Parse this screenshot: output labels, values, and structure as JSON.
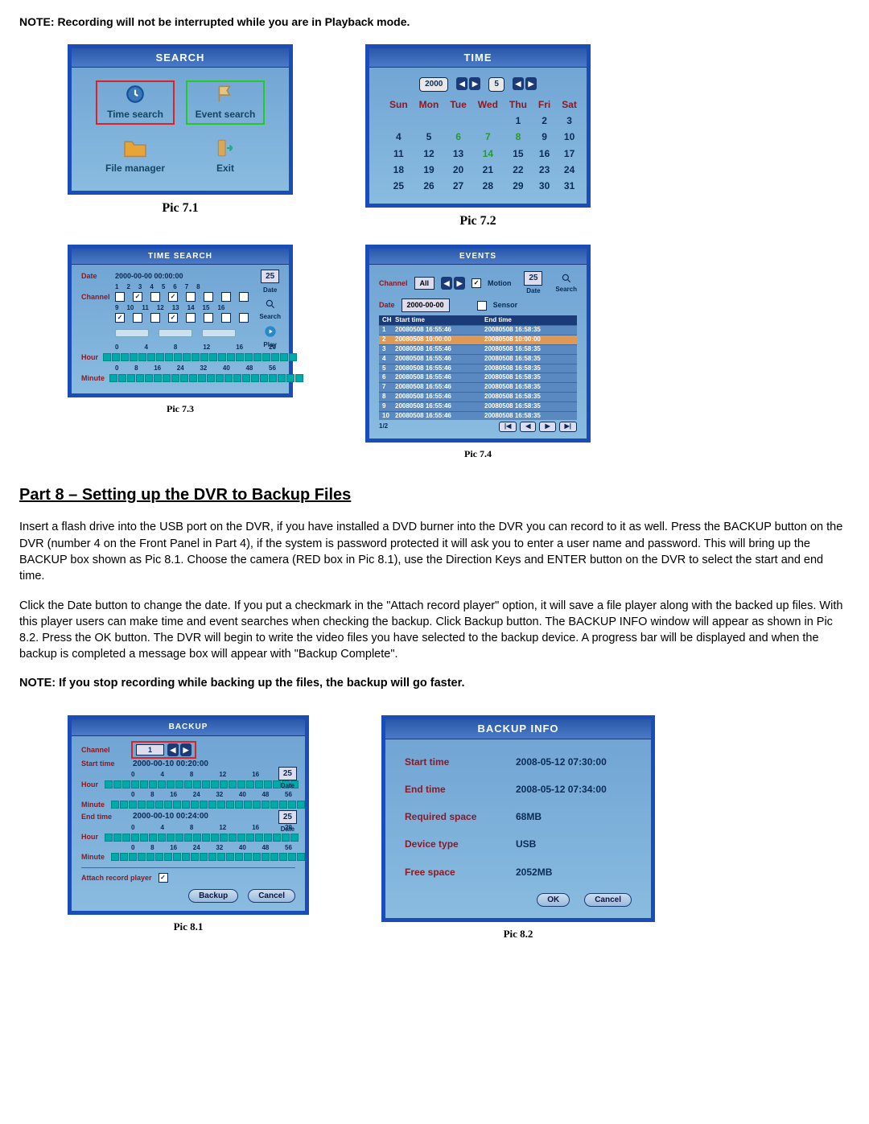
{
  "note_playback": "NOTE: Recording will not be interrupted while you are in Playback mode.",
  "pic71": {
    "title": "SEARCH",
    "items": {
      "time_search": "Time search",
      "event_search": "Event search",
      "file_manager": "File manager",
      "exit": "Exit"
    },
    "caption": "Pic 7.1"
  },
  "pic72": {
    "title": "TIME",
    "year": "2000",
    "month": "5",
    "days": [
      "Sun",
      "Mon",
      "Tue",
      "Wed",
      "Thu",
      "Fri",
      "Sat"
    ],
    "grid": [
      [
        "",
        "",
        "",
        "",
        "1",
        "2",
        "3"
      ],
      [
        "4",
        "5",
        "6",
        "7",
        "8",
        "9",
        "10"
      ],
      [
        "11",
        "12",
        "13",
        "14",
        "15",
        "16",
        "17"
      ],
      [
        "18",
        "19",
        "20",
        "21",
        "22",
        "23",
        "24"
      ],
      [
        "25",
        "26",
        "27",
        "28",
        "29",
        "30",
        "31"
      ]
    ],
    "caption": "Pic 7.2"
  },
  "pic73": {
    "title": "TIME SEARCH",
    "labels": {
      "date": "Date",
      "channel": "Channel",
      "hour": "Hour",
      "minute": "Minute",
      "search": "Search",
      "play": "Play"
    },
    "date_value": "2000-00-00  00:00:00",
    "side_date_value": "25",
    "ch_row1_nums": [
      "1",
      "2",
      "3",
      "4",
      "5",
      "6",
      "7",
      "8"
    ],
    "ch_row2_nums": [
      "9",
      "10",
      "11",
      "12",
      "13",
      "14",
      "15",
      "16"
    ],
    "hour_ticks": [
      "0",
      "4",
      "8",
      "12",
      "16",
      "20"
    ],
    "minute_ticks": [
      "0",
      "8",
      "16",
      "24",
      "32",
      "40",
      "48",
      "56"
    ],
    "caption": "Pic 7.3"
  },
  "pic74": {
    "title": "EVENTS",
    "labels": {
      "channel": "Channel",
      "all": "All",
      "motion": "Motion",
      "date": "Date",
      "sensor": "Sensor",
      "search": "Search",
      "date_side": "Date"
    },
    "date_value": "2000-00-00",
    "side_date_value": "25",
    "cols": {
      "ch": "CH",
      "start": "Start time",
      "end": "End time"
    },
    "rows": [
      {
        "ch": "1",
        "st": "20080508  16:55:46",
        "et": "20080508  16:58:35",
        "hl": false
      },
      {
        "ch": "2",
        "st": "20080508  10:00:00",
        "et": "20080508  10:00:00",
        "hl": true
      },
      {
        "ch": "3",
        "st": "20080508  16:55:46",
        "et": "20080508  16:58:35",
        "hl": false
      },
      {
        "ch": "4",
        "st": "20080508  16:55:46",
        "et": "20080508  16:58:35",
        "hl": false
      },
      {
        "ch": "5",
        "st": "20080508  16:55:46",
        "et": "20080508  16:58:35",
        "hl": false
      },
      {
        "ch": "6",
        "st": "20080508  16:55:46",
        "et": "20080508  16:58:35",
        "hl": false
      },
      {
        "ch": "7",
        "st": "20080508  16:55:46",
        "et": "20080508  16:58:35",
        "hl": false
      },
      {
        "ch": "8",
        "st": "20080508  16:55:46",
        "et": "20080508  16:58:35",
        "hl": false
      },
      {
        "ch": "9",
        "st": "20080508  16:55:46",
        "et": "20080508  16:58:35",
        "hl": false
      },
      {
        "ch": "10",
        "st": "20080508  16:55:46",
        "et": "20080508  16:58:35",
        "hl": false
      }
    ],
    "page": "1/2",
    "caption": "Pic 7.4"
  },
  "section8_title": "Part 8 – Setting up the DVR to Backup Files",
  "para1": "Insert a flash drive into the USB port on the DVR, if you have installed a DVD burner into the DVR you can record to it as well. Press the BACKUP button on the DVR (number 4 on the Front Panel in Part 4), if the system is password protected it will ask you to enter a user name and password. This will bring up the BACKUP box shown as Pic 8.1. Choose the camera (RED box in Pic 8.1), use the Direction Keys and ENTER button on the DVR to select the start and end time.",
  "para2": "Click the Date button to change the date. If you put a checkmark in the \"Attach record player\" option, it will save a file player along with the backed up files. With this player users can make time and event searches when checking the backup. Click Backup button. The BACKUP INFO window will appear as shown in Pic 8.2. Press the OK button. The DVR will begin to write the video files you have selected to the backup device. A progress bar will be displayed and when the backup is completed a message box will appear with \"Backup Complete\".",
  "note_backup": "NOTE: If you stop recording while backing up the files, the backup will go faster.",
  "pic81": {
    "title": "BACKUP",
    "labels": {
      "channel": "Channel",
      "start": "Start time",
      "hour": "Hour",
      "minute": "Minute",
      "end": "End time",
      "attach": "Attach record player",
      "date": "Date"
    },
    "channel_value": "1",
    "start_value": "2000-00-10  00:20:00",
    "end_value": "2000-00-10  00:24:00",
    "hour_ticks": [
      "0",
      "4",
      "8",
      "12",
      "16",
      "20"
    ],
    "min_ticks": [
      "0",
      "8",
      "16",
      "24",
      "32",
      "40",
      "48",
      "56"
    ],
    "side_date_value": "25",
    "buttons": {
      "backup": "Backup",
      "cancel": "Cancel"
    },
    "caption": "Pic 8.1"
  },
  "pic82": {
    "title": "BACKUP INFO",
    "rows": {
      "start": {
        "lbl": "Start time",
        "val": "2008-05-12  07:30:00"
      },
      "end": {
        "lbl": "End time",
        "val": "2008-05-12  07:34:00"
      },
      "space": {
        "lbl": "Required space",
        "val": "68MB"
      },
      "device": {
        "lbl": "Device type",
        "val": "USB"
      },
      "free": {
        "lbl": "Free space",
        "val": "2052MB"
      }
    },
    "buttons": {
      "ok": "OK",
      "cancel": "Cancel"
    },
    "caption": "Pic 8.2"
  }
}
